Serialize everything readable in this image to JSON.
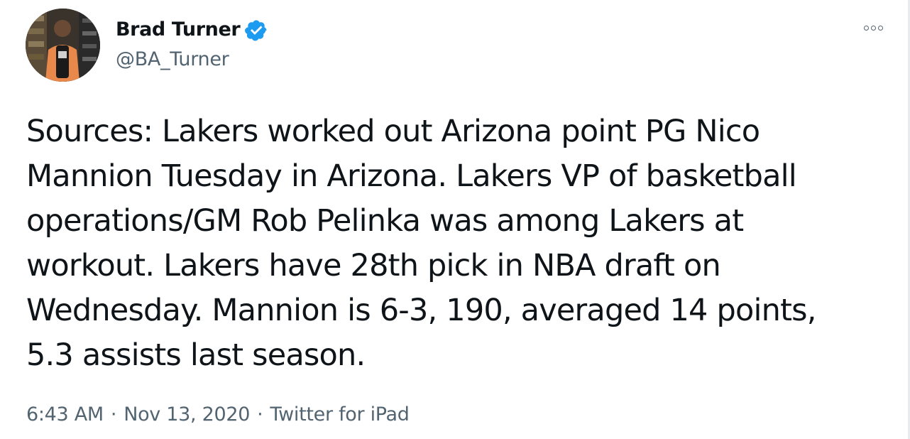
{
  "author": {
    "display_name": "Brad Turner",
    "handle": "@BA_Turner",
    "verified": true,
    "avatar_icon": "user-photo-avatar"
  },
  "tweet": {
    "text": "Sources: Lakers worked out Arizona point PG Nico\nMannion Tuesday in Arizona. Lakers VP of basketball\noperations/GM Rob Pelinka was among Lakers at\nworkout. Lakers have 28th pick in NBA draft on\nWednesday. Mannion is 6-3, 190, averaged 14 points,\n5.3 assists last season."
  },
  "meta": {
    "time": "6:43 AM",
    "date": "Nov 13, 2020",
    "source": "Twitter for iPad",
    "separator": "·"
  },
  "colors": {
    "verified_badge": "#1d9bf0",
    "secondary_text": "#536471",
    "primary_text": "#0f1419"
  },
  "icons": {
    "more": "more-options-icon",
    "verified": "verified-badge-icon"
  }
}
